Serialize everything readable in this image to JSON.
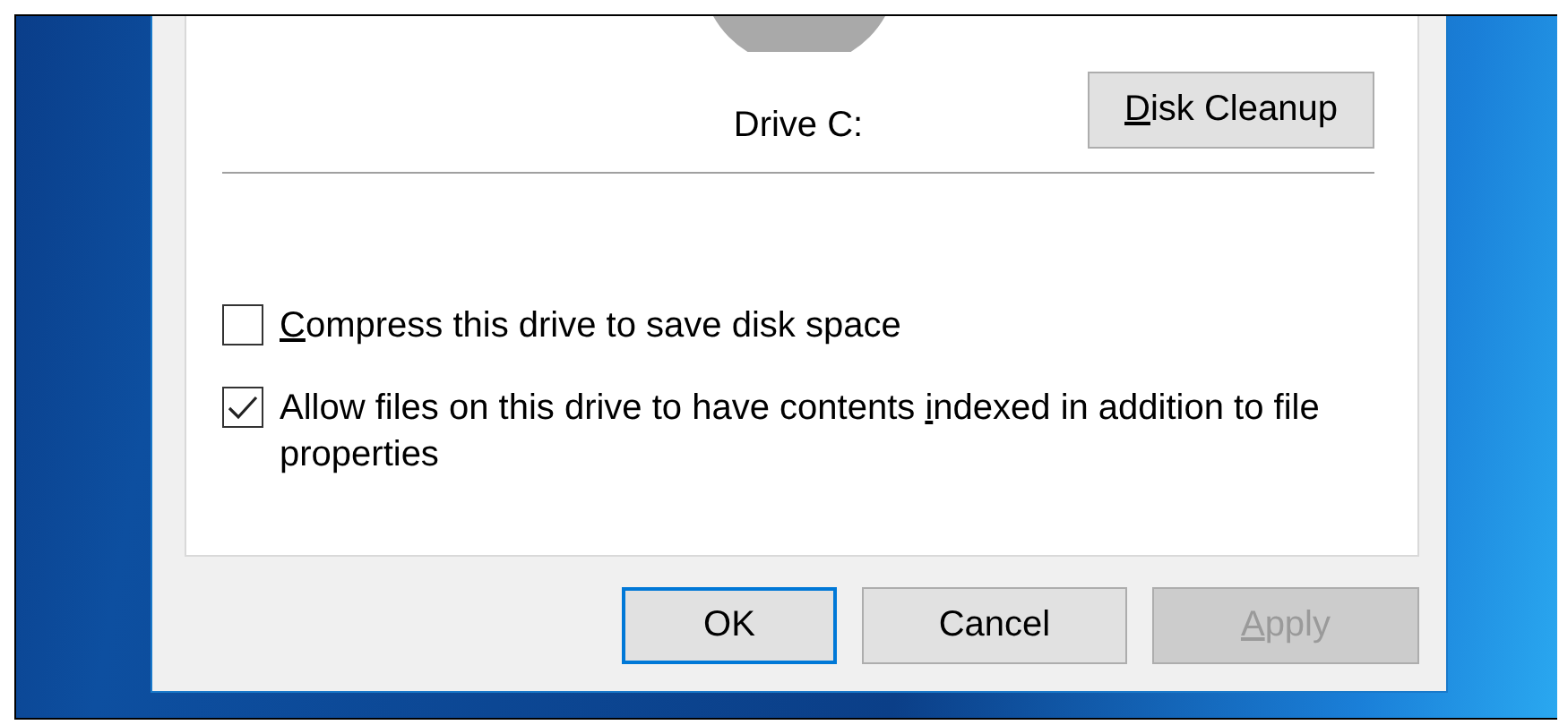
{
  "drive": {
    "label": "Drive C:",
    "cleanup_button": {
      "parts": [
        {
          "text": "D",
          "underline": true
        },
        {
          "text": "isk Cleanup",
          "underline": false
        }
      ]
    }
  },
  "options": [
    {
      "checked": false,
      "parts": [
        {
          "text": "C",
          "underline": true
        },
        {
          "text": "ompress this drive to save disk space",
          "underline": false
        }
      ]
    },
    {
      "checked": true,
      "parts": [
        {
          "text": "Allow files on this drive to have contents ",
          "underline": false
        },
        {
          "text": "i",
          "underline": true
        },
        {
          "text": "ndexed in addition to file properties",
          "underline": false
        }
      ]
    }
  ],
  "buttons": [
    {
      "parts": [
        {
          "text": "OK",
          "underline": false
        }
      ],
      "default": true,
      "disabled": false
    },
    {
      "parts": [
        {
          "text": "Cancel",
          "underline": false
        }
      ],
      "default": false,
      "disabled": false
    },
    {
      "parts": [
        {
          "text": "A",
          "underline": true
        },
        {
          "text": "pply",
          "underline": false
        }
      ],
      "default": false,
      "disabled": true
    }
  ]
}
